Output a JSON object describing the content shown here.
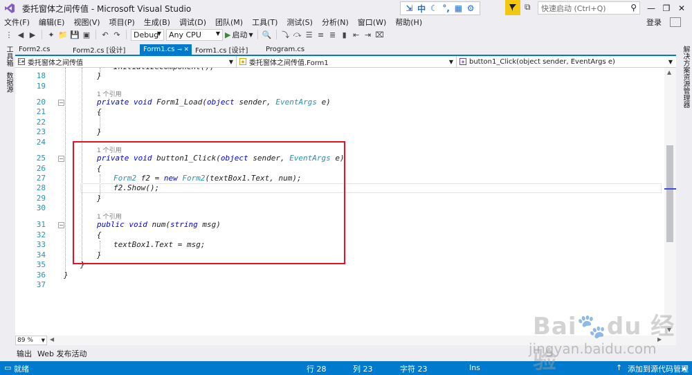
{
  "window": {
    "title": "委托窗体之间传值 - Microsoft Visual Studio",
    "quick_launch_placeholder": "快速启动 (Ctrl+Q)",
    "ime": [
      "中"
    ],
    "login": "登录"
  },
  "menu": [
    "文件(F)",
    "编辑(E)",
    "视图(V)",
    "项目(P)",
    "生成(B)",
    "调试(D)",
    "团队(M)",
    "工具(T)",
    "测试(S)",
    "分析(N)",
    "窗口(W)",
    "帮助(H)"
  ],
  "toolbar": {
    "config": "Debug",
    "platform": "Any CPU",
    "start_label": "启动"
  },
  "side_left": [
    "工具箱",
    "数据源"
  ],
  "side_right": [
    "解决方案资源管理器"
  ],
  "tabs": [
    {
      "label": "Form2.cs"
    },
    {
      "label": "Form2.cs [设计]"
    },
    {
      "label": "Form1.cs",
      "active": true
    },
    {
      "label": "Form1.cs [设计]"
    },
    {
      "label": "Program.cs"
    }
  ],
  "navbar": {
    "project": "委托窗体之间传值",
    "class": "委托窗体之间传值.Form1",
    "member": "button1_Click(object sender, EventArgs e)"
  },
  "editor": {
    "references_label": "1 个引用",
    "lines": {
      "n18": "18",
      "n19": "19",
      "n20": "20",
      "n21": "21",
      "n22": "22",
      "n23": "23",
      "n24": "24",
      "n25": "25",
      "n26": "26",
      "n27": "27",
      "n28": "28",
      "n29": "29",
      "n30": "30",
      "n31": "31",
      "n32": "32",
      "n33": "33",
      "n34": "34",
      "n35": "35",
      "n36": "36",
      "n37": "37"
    }
  },
  "zoom": "89 %",
  "output_tabs": [
    "输出",
    "Web 发布活动"
  ],
  "status": {
    "state": "就绪",
    "row": "行 28",
    "col": "列 23",
    "char": "字符 23",
    "mode": "Ins",
    "source_control": "添加到源代码管理"
  },
  "watermark": {
    "logo": "Bai du 经验",
    "url": "jingyan.baidu.com"
  },
  "colors": {
    "accent": "#007acc",
    "keyword": "#0000ff",
    "type": "#2b91af",
    "highlight_box": "#e81123"
  }
}
